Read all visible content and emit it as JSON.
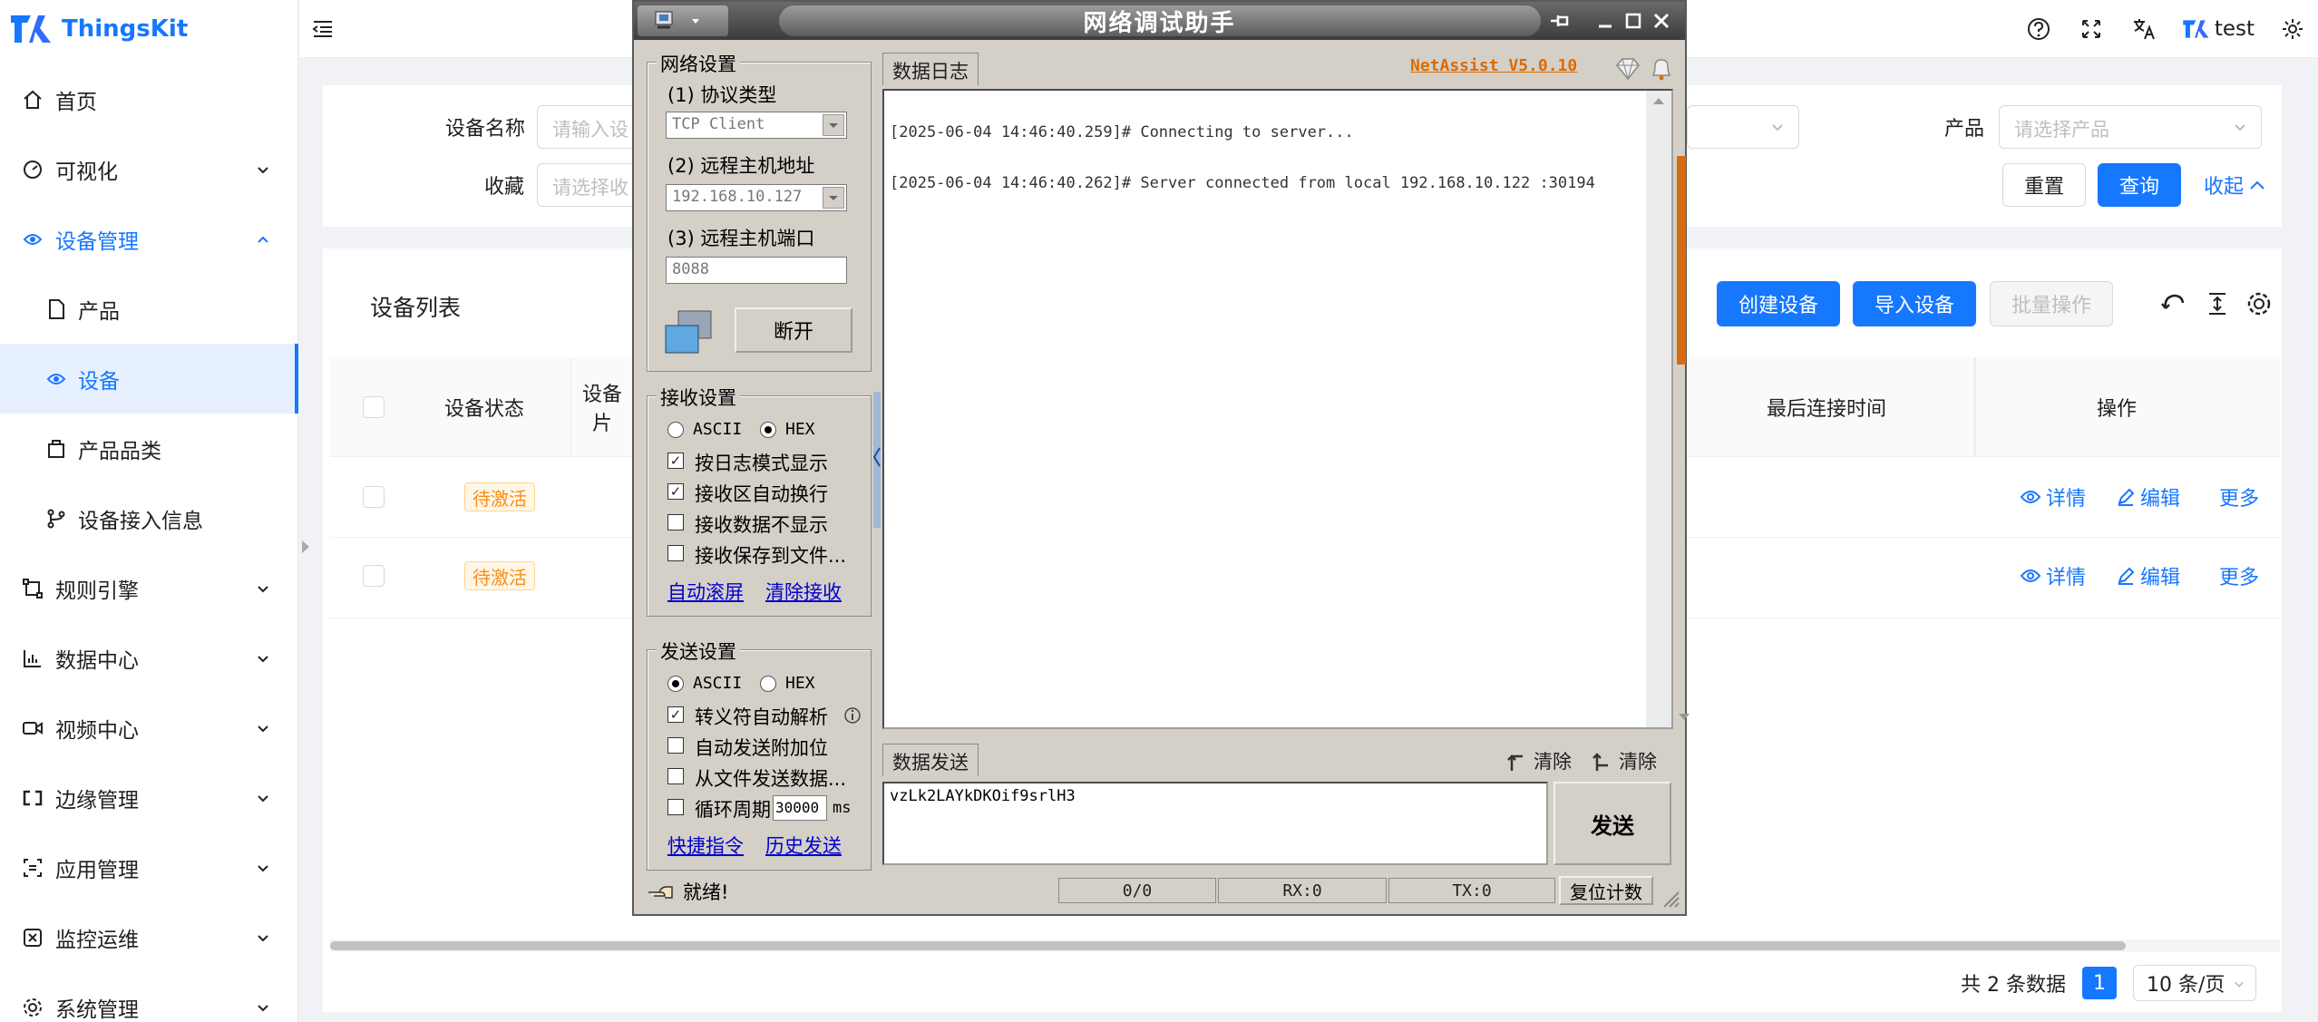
{
  "app": {
    "logo_text": "ThingsKit",
    "brand_color": "#1677ff"
  },
  "sidebar": {
    "items": [
      {
        "label": "首页",
        "icon": "home-icon"
      },
      {
        "label": "可视化",
        "icon": "dashboard-icon"
      },
      {
        "label": "设备管理",
        "icon": "device-icon"
      },
      {
        "label": "产品",
        "icon": "file-icon"
      },
      {
        "label": "设备",
        "icon": "device-icon"
      },
      {
        "label": "产品品类",
        "icon": "category-icon"
      },
      {
        "label": "设备接入信息",
        "icon": "branch-icon"
      },
      {
        "label": "规则引擎",
        "icon": "rule-icon"
      },
      {
        "label": "数据中心",
        "icon": "chart-icon"
      },
      {
        "label": "视频中心",
        "icon": "video-icon"
      },
      {
        "label": "边缘管理",
        "icon": "edge-icon"
      },
      {
        "label": "应用管理",
        "icon": "app-icon"
      },
      {
        "label": "监控运维",
        "icon": "monitor-icon"
      },
      {
        "label": "系统管理",
        "icon": "settings-icon"
      }
    ]
  },
  "header": {
    "user": "test"
  },
  "search": {
    "device_name_label": "设备名称",
    "device_name_placeholder": "请输入设",
    "favorite_label": "收藏",
    "favorite_placeholder": "请选择收",
    "product_label": "产品",
    "product_placeholder": "请选择产品",
    "reset": "重置",
    "query": "查询",
    "collapse": "收起"
  },
  "table": {
    "title": "设备列表",
    "create": "创建设备",
    "import": "导入设备",
    "batch": "批量操作",
    "columns": {
      "status": "设备状态",
      "image_top": "设备",
      "image_bottom": "片",
      "last_connect": "最后连接时间",
      "actions": "操作"
    },
    "rows": [
      {
        "status": "待激活"
      },
      {
        "status": "待激活"
      }
    ],
    "actions": {
      "detail": "详情",
      "edit": "编辑",
      "more": "更多"
    },
    "total": "共 2 条数据",
    "page": "1",
    "page_size": "10 条/页"
  },
  "netassist": {
    "title": "网络调试助手",
    "version": "NetAssist V5.0.10",
    "net_settings": "网络设置",
    "protocol_label": "(1) 协议类型",
    "protocol_value": "TCP Client",
    "host_label": "(2) 远程主机地址",
    "host_value": "192.168.10.127",
    "port_label": "(3) 远程主机端口",
    "port_value": "8088",
    "disconnect": "断开",
    "recv_settings": "接收设置",
    "ascii": "ASCII",
    "hex": "HEX",
    "recv_opt1": "按日志模式显示",
    "recv_opt2": "接收区自动换行",
    "recv_opt3": "接收数据不显示",
    "recv_opt4": "接收保存到文件...",
    "auto_scroll": "自动滚屏",
    "clear_recv": "清除接收",
    "send_settings": "发送设置",
    "send_opt1": "转义符自动解析",
    "send_opt2": "自动发送附加位",
    "send_opt3": "从文件发送数据...",
    "send_opt4": "循环周期",
    "period_value": "30000",
    "period_unit": "ms",
    "shortcut": "快捷指令",
    "history": "历史发送",
    "log_tab": "数据日志",
    "log_lines": [
      "[2025-06-04 14:46:40.259]# Connecting to server...",
      "[2025-06-04 14:46:40.262]# Server connected from local 192.168.10.122 :30194"
    ],
    "send_tab": "数据发送",
    "clear1": "清除",
    "clear2": "清除",
    "send_text": "vzLk2LAYkDKOif9srlH3",
    "send_button": "发送",
    "status_ready": "就绪!",
    "count": "0/0",
    "rx": "RX:0",
    "tx": "TX:0",
    "reset_count": "复位计数"
  }
}
